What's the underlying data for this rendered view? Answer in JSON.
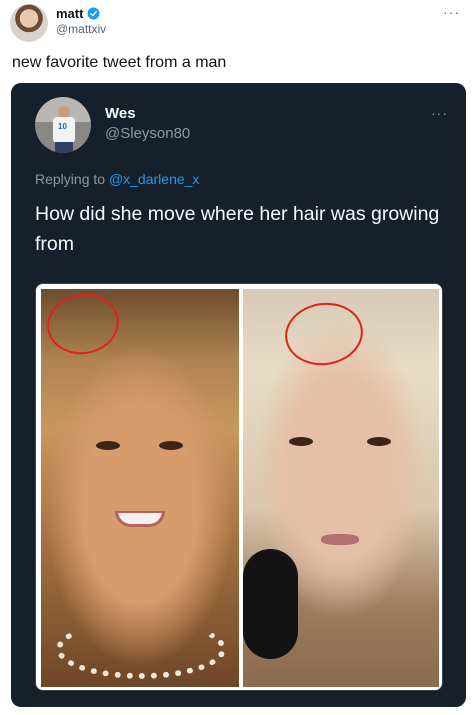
{
  "outer_tweet": {
    "name": "matt",
    "handle": "@mattxiv",
    "text": "new favorite tweet from a man",
    "more_label": "···",
    "verified_color": "#1d9bf0"
  },
  "quoted_tweet": {
    "name": "Wes",
    "handle": "@Sleyson80",
    "more_label": "···",
    "replying_prefix": "Replying to ",
    "replying_mention": "@x_darlene_x",
    "text": "How did she move where her hair was growing from",
    "avatar_jersey_number": "10",
    "background_color": "#15202b",
    "mention_color": "#1d9bf0"
  },
  "media": {
    "left_photo": "young-woman-smiling-blonde-hair",
    "right_photo": "woman-blonde-hair-with-microphone",
    "annotation_color": "#e2211c"
  }
}
